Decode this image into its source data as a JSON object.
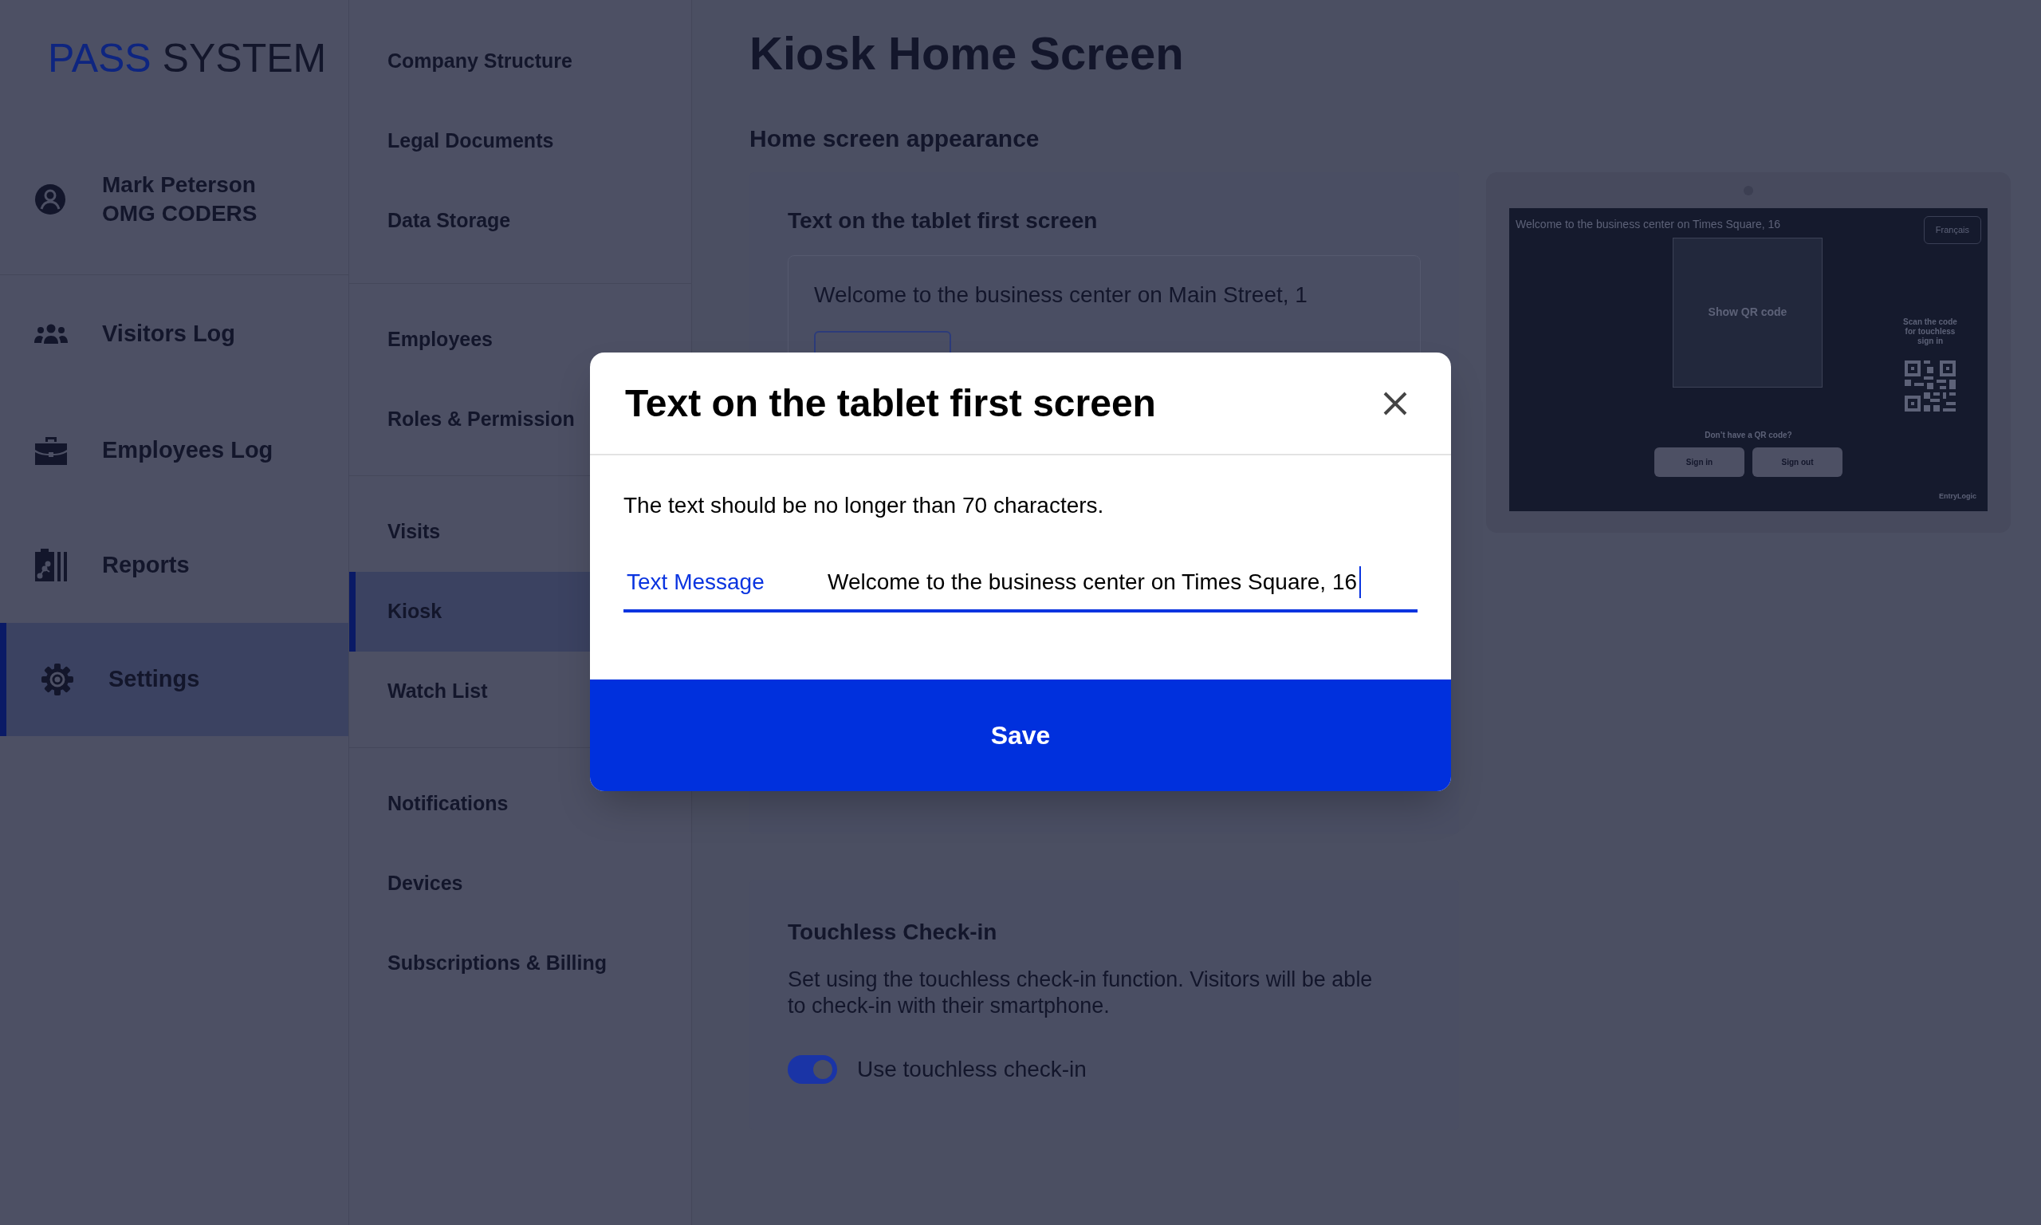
{
  "brand": {
    "part_1": "PASS",
    "part_2": "SYSTEM"
  },
  "user": {
    "name": "Mark Peterson",
    "company": "OMG CODERS"
  },
  "nav": [
    {
      "label": "Visitors Log",
      "kind": "visitors",
      "selected": false
    },
    {
      "label": "Employees Log",
      "kind": "employees",
      "selected": false
    },
    {
      "label": "Reports",
      "kind": "reports",
      "selected": false
    },
    {
      "label": "Settings",
      "kind": "settings",
      "selected": true
    }
  ],
  "settings_menu": [
    {
      "items": [
        {
          "label": "Company Structure",
          "selected": false
        },
        {
          "label": "Legal Documents",
          "selected": false
        },
        {
          "label": "Data Storage",
          "selected": false
        }
      ]
    },
    {
      "items": [
        {
          "label": "Employees",
          "selected": false
        },
        {
          "label": "Roles & Permission",
          "selected": false
        }
      ]
    },
    {
      "items": [
        {
          "label": "Visits",
          "selected": false
        },
        {
          "label": "Kiosk",
          "selected": true
        },
        {
          "label": "Watch List",
          "selected": false
        }
      ]
    },
    {
      "items": [
        {
          "label": "Notifications",
          "selected": false
        },
        {
          "label": "Devices",
          "selected": false
        },
        {
          "label": "Subscriptions & Billing",
          "selected": false
        }
      ]
    }
  ],
  "page": {
    "title": "Kiosk Home Screen",
    "section_title": "Home screen appearance"
  },
  "text_card": {
    "title": "Text on the tablet first screen",
    "value": "Welcome to the business center on Main Street, 1"
  },
  "tablet_preview": {
    "welcome": "Welcome to the business center on Times Square, 16",
    "language_button": "Français",
    "qr_prompt": "Show QR code",
    "scan_hint": "Scan the code for touchless sign in",
    "no_qr": "Don’t have a QR code?",
    "buttons": [
      "Sign in",
      "Sign out"
    ],
    "logo": "EntryLogic"
  },
  "touchless": {
    "title": "Touchless Check-in",
    "description": "Set using the touchless check-in function. Visitors will be able to check-in with their smartphone.",
    "toggle": {
      "label": "Use touchless check-in",
      "on": true
    }
  },
  "dialog": {
    "title": "Text on the tablet first screen",
    "hint": "The text should be no longer than 70 characters.",
    "field": {
      "label": "Text Message",
      "value": "Welcome to the business center on Times Square, 16"
    },
    "save_button": "Save"
  }
}
